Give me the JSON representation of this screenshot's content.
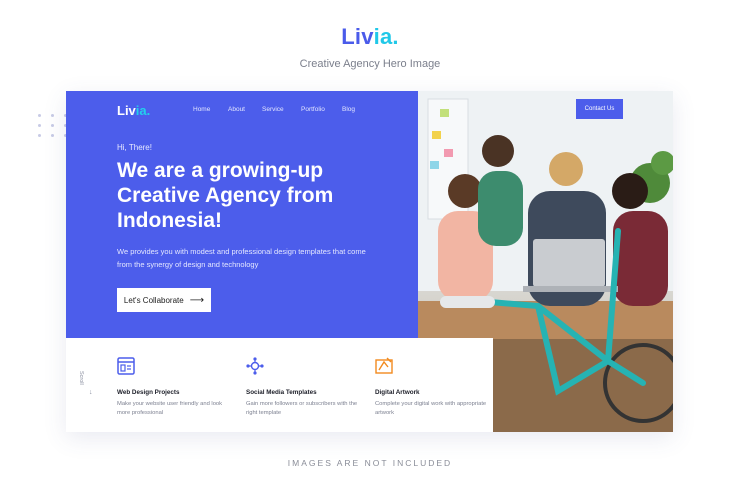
{
  "showcase": {
    "logo_main": "Liv",
    "logo_accent": "ia",
    "logo_dot": ".",
    "subtitle": "Creative Agency Hero Image",
    "footer_note": "IMAGES ARE NOT INCLUDED"
  },
  "nav": {
    "logo_main": "Liv",
    "logo_accent": "ia",
    "logo_dot": ".",
    "links": [
      "Home",
      "About",
      "Service",
      "Portfolio",
      "Blog"
    ],
    "cta": "Contact Us"
  },
  "hero": {
    "greeting": "Hi, There!",
    "title": "We are a growing-up Creative Agency from Indonesia!",
    "description": "We provides you with modest and professional design templates that come from the synergy of design and technology",
    "button_label": "Let's Collaborate",
    "button_icon": "arrow-right-icon"
  },
  "scroll": {
    "label": "Scroll"
  },
  "features": [
    {
      "icon": "browser-layout-icon",
      "title": "Web Design Projects",
      "description": "Make your website user friendly and look more professional"
    },
    {
      "icon": "network-nodes-icon",
      "title": "Social Media Templates",
      "description": "Gain more followers or subscribers with the right template"
    },
    {
      "icon": "design-tools-icon",
      "title": "Digital Artwork",
      "description": "Complete your digital work with appropriate artwork"
    }
  ],
  "colors": {
    "primary": "#4C5DEB",
    "accent": "#21D1EC",
    "icon_blue": "#4C5DEB",
    "icon_orange": "#F28A1E"
  }
}
